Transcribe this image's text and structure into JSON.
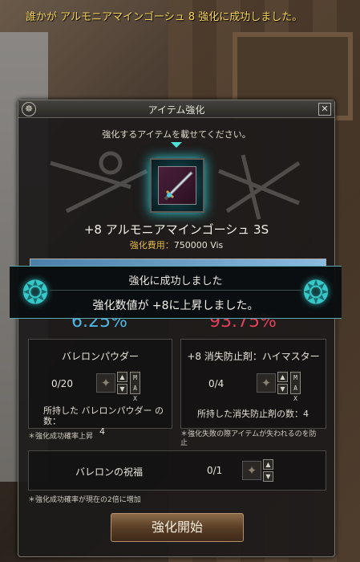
{
  "system_message": "誰かが アルモニアマインゴーシュ 8 強化に成功しました。",
  "window": {
    "title": "アイテム強化",
    "logo": "☸",
    "close": "✕",
    "hint": "強化するアイテムを載せてください。"
  },
  "item": {
    "name": "+8 アルモニアマインゴーシュ 3S",
    "icon": "dagger-icon",
    "cost_label": "強化費用：",
    "cost_value": "750000 Vis"
  },
  "progress": {
    "fill": 1.0,
    "color": "#6fa2cc"
  },
  "rates": {
    "success": "6.25%",
    "fail": "93.75%"
  },
  "powder": {
    "title": "バレロンパウダー",
    "count": "0/20",
    "owned_line1": "所持した バレロンパウダー の数：",
    "owned_line2": "4",
    "note": "＊強化成功確率上昇"
  },
  "antiloss": {
    "title": "+8 消失防止剤：ハイマスター",
    "count": "0/4",
    "owned": "所持した消失防止剤の数：4",
    "note_line1": "＊強化失敗の際アイテムが失われるのを防",
    "note_line2": "止"
  },
  "blessing": {
    "title": "バレロンの祝福",
    "count": "0/1",
    "note": "＊強化成功確率が現在の2倍に増加"
  },
  "stepper": {
    "up": "▲",
    "down": "▼",
    "max": "M A X"
  },
  "start_button": "強化開始",
  "banner": {
    "head": "強化に成功しました",
    "text": "強化数値が +8に上昇しました。",
    "ornament": "❂"
  },
  "colors": {
    "accent": "#36c7c9",
    "success": "#4eb6e6",
    "fail": "#e0405a",
    "cost": "#e6b84a",
    "sysmsg": "#f3d35a"
  }
}
